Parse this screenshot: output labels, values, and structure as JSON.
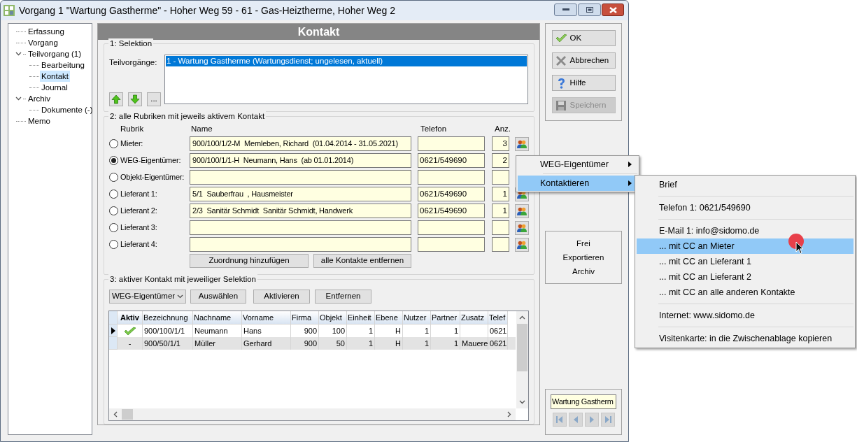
{
  "window": {
    "title": "Vorgang 1 \"Wartung Gastherme\" - Hoher Weg 59 - 61 - Gas-Heiztherme, Hoher Weg 2"
  },
  "tree": [
    {
      "label": "Erfassung",
      "selected": false
    },
    {
      "label": "Vorgang",
      "selected": false
    },
    {
      "label": "Teilvorgang (1)",
      "selected": false,
      "expanded": true,
      "children": [
        {
          "label": "Bearbeitung",
          "selected": false
        },
        {
          "label": "Kontakt",
          "selected": true
        },
        {
          "label": "Journal",
          "selected": false
        }
      ]
    },
    {
      "label": "Archiv",
      "selected": false,
      "expanded": true,
      "children": [
        {
          "label": "Dokumente (-)",
          "selected": false
        }
      ]
    },
    {
      "label": "Memo",
      "selected": false
    }
  ],
  "header": "Kontakt",
  "selection": {
    "legend": "1: Selektion",
    "label": "Teilvorgänge:",
    "items": [
      {
        "label": "1 - Wartung Gastherme (Wartungsdienst;  ungelesen, aktuell)",
        "selected": true
      }
    ],
    "more_button": "..."
  },
  "rubriken": {
    "legend": "2: alle Rubriken mit jeweils aktivem Kontakt",
    "columns": [
      "Rubrik",
      "Name",
      "Telefon",
      "Anz."
    ],
    "rows": [
      {
        "label": "Mieter:",
        "selected": false,
        "name": "900/100/1/2-M  Memleben, Richard  (01.04.2014 - 31.05.2021)",
        "count": "3",
        "contact_button": true
      },
      {
        "label": "WEG-Eigentümer:",
        "selected": true,
        "name": "900/100/1/1-H  Neumann, Hans  (ab 01.01.2014)",
        "phone": "0621/549690",
        "count": "2",
        "contact_button": false
      },
      {
        "label": "Objekt-Eigentümer:",
        "selected": false,
        "contact_button": false
      },
      {
        "label": "Lieferant 1:",
        "selected": false,
        "name": "5/1  Sauberfrau  , Hausmeister",
        "phone": "0621/549690",
        "count": "1",
        "contact_button": true
      },
      {
        "label": "Lieferant 2:",
        "selected": false,
        "name": "2/3  Sanitär Schmidt  Sanitär Schmidt, Handwerk",
        "phone": "0621/549690",
        "count": "1",
        "contact_button": true
      },
      {
        "label": "Lieferant 3:",
        "selected": false,
        "contact_button": true
      },
      {
        "label": "Lieferant 4:",
        "selected": false,
        "contact_button": true
      }
    ],
    "buttons": [
      "Zuordnung hinzufügen",
      "alle Kontakte entfernen"
    ]
  },
  "active_contact": {
    "legend": "3: aktiver Kontakt mit jeweiliger Selektion",
    "dropdown": "WEG-Eigentümer",
    "buttons": [
      "Auswählen",
      "Aktivieren",
      "Entfernen"
    ],
    "table": {
      "columns": [
        "Aktiv",
        "Bezeichnung",
        "Nachname",
        "Vorname",
        "Firma",
        "Objekt",
        "Einheit",
        "Ebene",
        "Nutzer",
        "Partner",
        "Zusatz",
        "Telef"
      ],
      "rows": [
        {
          "current": true,
          "active": true,
          "cells": [
            "",
            "900/100/1/1",
            "Neumann",
            "Hans",
            "900",
            "100",
            "1",
            "H",
            "1",
            "1",
            "",
            "0621"
          ]
        },
        {
          "current": false,
          "active": false,
          "cells": [
            "-",
            "900/50/1/1",
            "Müller",
            "Gerhard",
            "900",
            "50",
            "1",
            "H",
            "1",
            "1",
            "Mauere",
            "0621"
          ]
        }
      ]
    }
  },
  "actions": [
    {
      "label": "OK",
      "disabled": false
    },
    {
      "label": "Abbrechen",
      "disabled": false
    },
    {
      "label": "Hilfe",
      "disabled": false
    },
    {
      "label": "Speichern",
      "disabled": true
    }
  ],
  "side_links": [
    "Frei",
    "Exportieren",
    "Archiv"
  ],
  "navigator": {
    "value": "Wartung Gastherm"
  },
  "context_menu": {
    "items": [
      {
        "kind": "item",
        "label": "WEG-Eigentümer",
        "submenu": true,
        "selected": false
      },
      {
        "kind": "separator"
      },
      {
        "kind": "item",
        "label": "Kontaktieren",
        "submenu": true,
        "selected": true
      }
    ]
  },
  "submenu": {
    "items": [
      {
        "kind": "item",
        "label": "Brief",
        "selected": false
      },
      {
        "kind": "separator"
      },
      {
        "kind": "item",
        "label": "Telefon 1: 0621/549690",
        "selected": false
      },
      {
        "kind": "separator"
      },
      {
        "kind": "item",
        "label": "E-Mail 1: info@sidomo.de",
        "selected": false
      },
      {
        "kind": "item",
        "label": "... mit CC an Mieter",
        "selected": true
      },
      {
        "kind": "item",
        "label": "... mit CC an Lieferant 1",
        "selected": false
      },
      {
        "kind": "item",
        "label": "... mit CC an Lieferant 2",
        "selected": false
      },
      {
        "kind": "item",
        "label": "... mit CC an alle anderen Kontakte",
        "selected": false
      },
      {
        "kind": "separator"
      },
      {
        "kind": "item",
        "label": "Internet: www.sidomo.de",
        "selected": false
      },
      {
        "kind": "separator"
      },
      {
        "kind": "item",
        "label": "Visitenkarte: in die Zwischenablage kopieren",
        "selected": false
      }
    ]
  }
}
